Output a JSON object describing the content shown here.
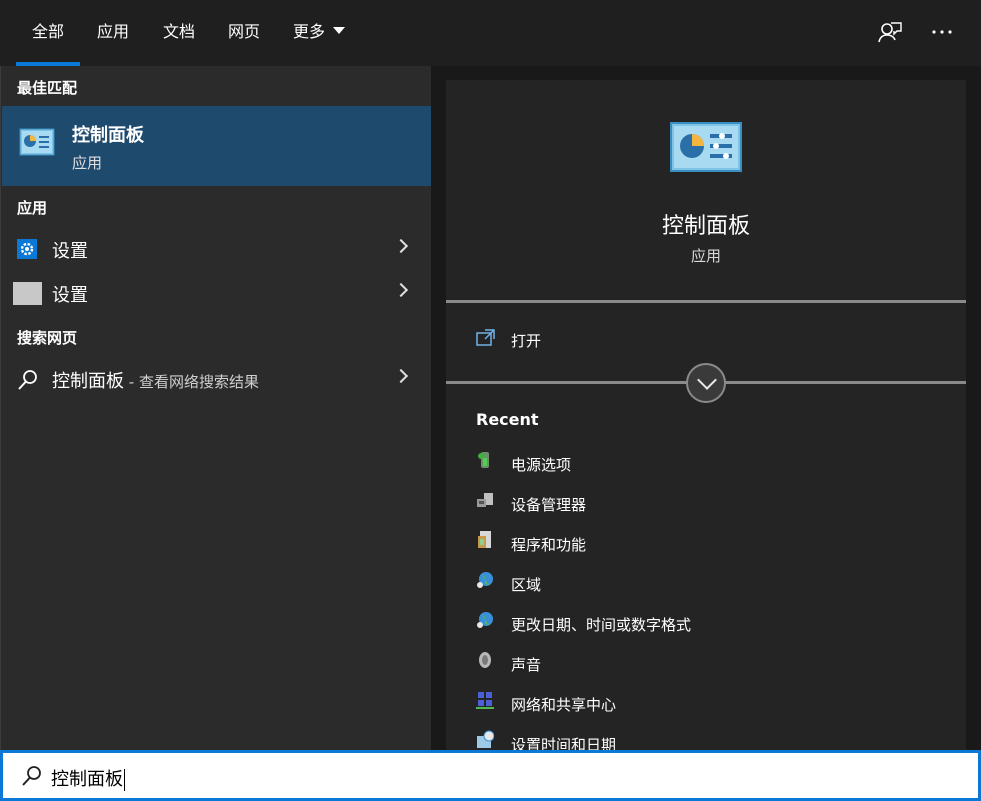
{
  "tabs": [
    {
      "label": "全部",
      "active": true
    },
    {
      "label": "应用"
    },
    {
      "label": "文档"
    },
    {
      "label": "网页"
    },
    {
      "label": "更多"
    }
  ],
  "left": {
    "best_match_heading": "最佳匹配",
    "best_match": {
      "title": "控制面板",
      "subtitle": "应用"
    },
    "apps_heading": "应用",
    "apps": [
      {
        "label": "设置",
        "icon": "gear-icon"
      },
      {
        "label": "设置",
        "icon": "blank-app-icon"
      }
    ],
    "web_heading": "搜索网页",
    "web_result": {
      "label": "控制面板",
      "suffix": " - 查看网络搜索结果"
    }
  },
  "right": {
    "title": "控制面板",
    "subtitle": "应用",
    "open_label": "打开",
    "recent_heading": "Recent",
    "recent": [
      {
        "label": "电源选项",
        "icon": "power-options-icon"
      },
      {
        "label": "设备管理器",
        "icon": "device-manager-icon"
      },
      {
        "label": "程序和功能",
        "icon": "programs-icon"
      },
      {
        "label": "区域",
        "icon": "region-globe-icon"
      },
      {
        "label": "更改日期、时间或数字格式",
        "icon": "globe-clock-icon"
      },
      {
        "label": "声音",
        "icon": "sound-icon"
      },
      {
        "label": "网络和共享中心",
        "icon": "network-icon"
      },
      {
        "label": "设置时间和日期",
        "icon": "datetime-icon"
      }
    ]
  },
  "search": {
    "value": "控制面板"
  },
  "colors": {
    "accent": "#0a78d4",
    "selected": "#1e4a6e"
  }
}
